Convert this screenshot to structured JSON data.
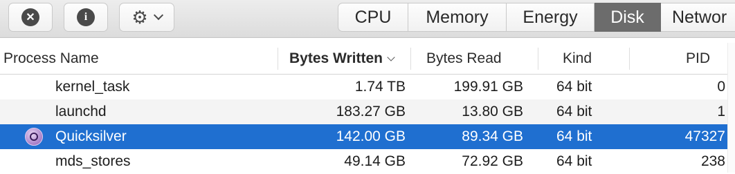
{
  "toolbar": {
    "stop_icon": "x-circle-icon",
    "info_icon": "info-circle-icon",
    "gear_icon": "gear-icon",
    "stop_glyph": "✕",
    "info_glyph": "i",
    "gear_glyph": "⚙"
  },
  "tabs": [
    {
      "label": "CPU",
      "active": false
    },
    {
      "label": "Memory",
      "active": false
    },
    {
      "label": "Energy",
      "active": false
    },
    {
      "label": "Disk",
      "active": true
    },
    {
      "label": "Networ",
      "active": false
    }
  ],
  "columns": {
    "process_name": "Process Name",
    "bytes_written": "Bytes Written",
    "bytes_read": "Bytes Read",
    "kind": "Kind",
    "pid": "PID"
  },
  "rows": [
    {
      "name": "kernel_task",
      "bytes_written": "1.74 TB",
      "bytes_read": "199.91 GB",
      "kind": "64 bit",
      "pid": "0",
      "selected": false,
      "icon": ""
    },
    {
      "name": "launchd",
      "bytes_written": "183.27 GB",
      "bytes_read": "13.80 GB",
      "kind": "64 bit",
      "pid": "1",
      "selected": false,
      "icon": ""
    },
    {
      "name": "Quicksilver",
      "bytes_written": "142.00 GB",
      "bytes_read": "89.34 GB",
      "kind": "64 bit",
      "pid": "47327",
      "selected": true,
      "icon": "quicksilver-app-icon"
    },
    {
      "name": "mds_stores",
      "bytes_written": "49.14 GB",
      "bytes_read": "72.92 GB",
      "kind": "64 bit",
      "pid": "238",
      "selected": false,
      "icon": ""
    }
  ],
  "colors": {
    "selection": "#1f6fd0",
    "active_tab": "#6c6c6c"
  }
}
